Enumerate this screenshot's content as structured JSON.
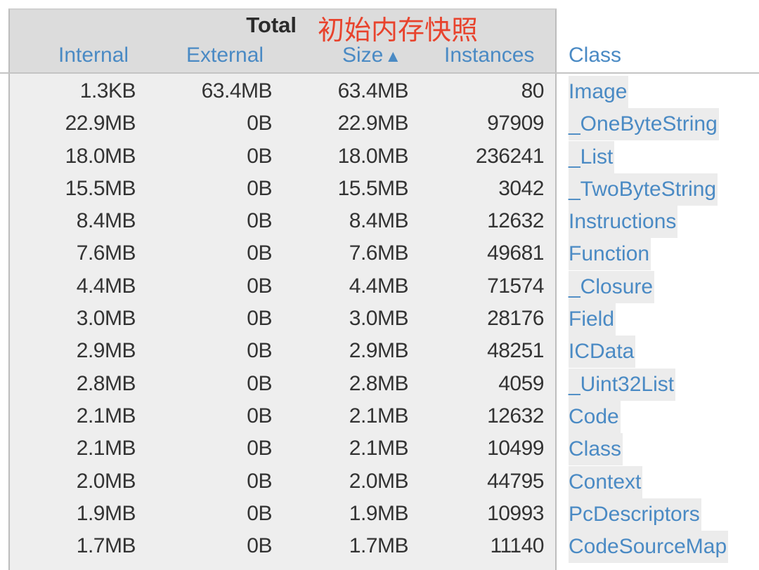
{
  "header": {
    "group_title": "Total",
    "annotation": "初始内存快照",
    "columns": {
      "internal": "Internal",
      "external": "External",
      "size": "Size",
      "size_sort_indicator": "▲",
      "instances": "Instances",
      "class": "Class"
    }
  },
  "colors": {
    "link": "#4a8ac4",
    "annotation": "#e8432d",
    "header_bg": "#dcdcdc",
    "body_bg": "#eeeeee"
  },
  "rows": [
    {
      "internal": "1.3KB",
      "external": "63.4MB",
      "size": "63.4MB",
      "instances": "80",
      "class": "Image"
    },
    {
      "internal": "22.9MB",
      "external": "0B",
      "size": "22.9MB",
      "instances": "97909",
      "class": "_OneByteString"
    },
    {
      "internal": "18.0MB",
      "external": "0B",
      "size": "18.0MB",
      "instances": "236241",
      "class": "_List"
    },
    {
      "internal": "15.5MB",
      "external": "0B",
      "size": "15.5MB",
      "instances": "3042",
      "class": "_TwoByteString"
    },
    {
      "internal": "8.4MB",
      "external": "0B",
      "size": "8.4MB",
      "instances": "12632",
      "class": "Instructions"
    },
    {
      "internal": "7.6MB",
      "external": "0B",
      "size": "7.6MB",
      "instances": "49681",
      "class": "Function"
    },
    {
      "internal": "4.4MB",
      "external": "0B",
      "size": "4.4MB",
      "instances": "71574",
      "class": "_Closure"
    },
    {
      "internal": "3.0MB",
      "external": "0B",
      "size": "3.0MB",
      "instances": "28176",
      "class": "Field"
    },
    {
      "internal": "2.9MB",
      "external": "0B",
      "size": "2.9MB",
      "instances": "48251",
      "class": "ICData"
    },
    {
      "internal": "2.8MB",
      "external": "0B",
      "size": "2.8MB",
      "instances": "4059",
      "class": "_Uint32List"
    },
    {
      "internal": "2.1MB",
      "external": "0B",
      "size": "2.1MB",
      "instances": "12632",
      "class": "Code"
    },
    {
      "internal": "2.1MB",
      "external": "0B",
      "size": "2.1MB",
      "instances": "10499",
      "class": "Class"
    },
    {
      "internal": "2.0MB",
      "external": "0B",
      "size": "2.0MB",
      "instances": "44795",
      "class": "Context"
    },
    {
      "internal": "1.9MB",
      "external": "0B",
      "size": "1.9MB",
      "instances": "10993",
      "class": "PcDescriptors"
    },
    {
      "internal": "1.7MB",
      "external": "0B",
      "size": "1.7MB",
      "instances": "11140",
      "class": "CodeSourceMap"
    }
  ]
}
